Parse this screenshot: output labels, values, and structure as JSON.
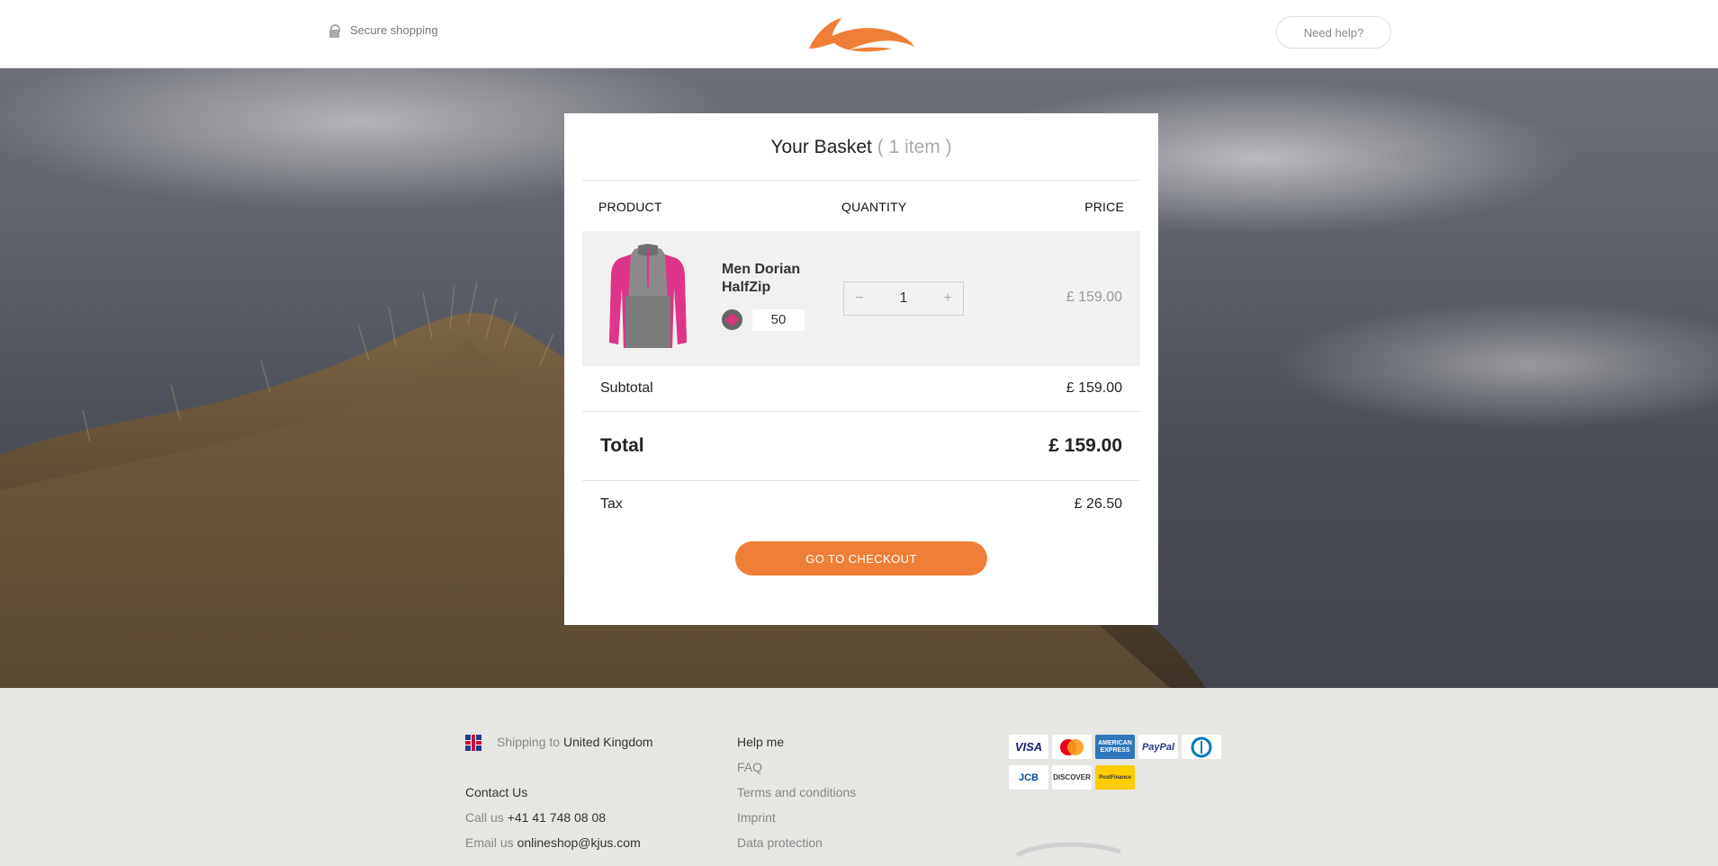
{
  "header": {
    "secure_label": "Secure shopping",
    "help_label": "Need help?",
    "logo_icon": "kjus-swoosh-logo",
    "accent": "#ef7f38"
  },
  "basket": {
    "title": "Your Basket",
    "count": "( 1 item )",
    "columns": {
      "product": "PRODUCT",
      "quantity": "QUANTITY",
      "price": "PRICE"
    },
    "items": [
      {
        "name": "Men Dorian HalfZip",
        "color_swatch": "grey-pink",
        "size": "50",
        "quantity": "1",
        "price": "£ 159.00"
      }
    ],
    "qty_minus": "−",
    "qty_plus": "+",
    "subtotal_label": "Subtotal",
    "subtotal_value": "£ 159.00",
    "total_label": "Total",
    "total_value": "£ 159.00",
    "tax_label": "Tax",
    "tax_value": "£ 26.50",
    "checkout_label": "GO TO CHECKOUT"
  },
  "footer": {
    "shipping_prefix": "Shipping to",
    "shipping_country": "United Kingdom",
    "contact_title": "Contact Us",
    "call_prefix": "Call us",
    "phone": "+41 41 748 08 08",
    "email_prefix": "Email us",
    "email": "onlineshop@kjus.com",
    "links": [
      "Help me",
      "FAQ",
      "Terms and conditions",
      "Imprint",
      "Data protection"
    ],
    "payments": [
      "VISA",
      "MasterCard",
      "AMERICAN EXPRESS",
      "PayPal",
      "Diners",
      "JCB",
      "DISCOVER",
      "PostFinance"
    ]
  }
}
